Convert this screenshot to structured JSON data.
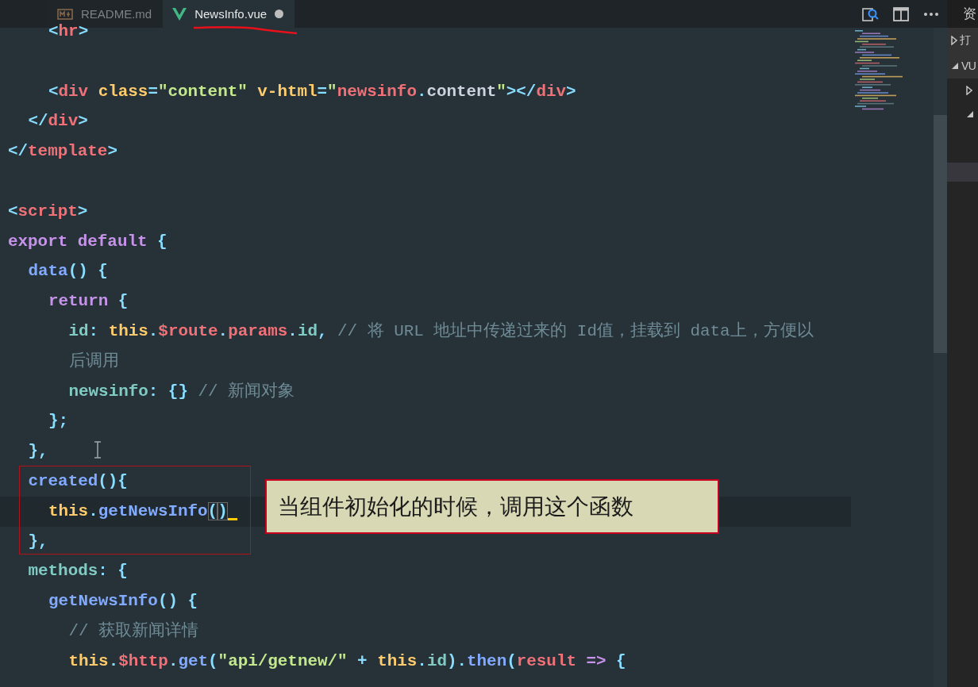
{
  "tabs": [
    {
      "label": "README.md",
      "kind": "markdown",
      "selected": false,
      "modified": false
    },
    {
      "label": "NewsInfo.vue",
      "kind": "vue",
      "selected": true,
      "modified": true
    }
  ],
  "editor": {
    "lines": [
      {
        "children": [
          {
            "children": [
              {
                "tokens": [
                  {
                    "kind": "punct",
                    "text": "<"
                  },
                  {
                    "kind": "tag",
                    "text": "hr"
                  },
                  {
                    "kind": "punct",
                    "text": ">"
                  }
                ]
              },
              {
                "kind": "blank"
              },
              {
                "tokens": [
                  {
                    "kind": "punct",
                    "text": "<"
                  },
                  {
                    "kind": "tag",
                    "text": "div "
                  },
                  {
                    "kind": "attr",
                    "text": "class"
                  },
                  {
                    "kind": "punct",
                    "text": "="
                  },
                  {
                    "kind": "string",
                    "text": "\"content\" "
                  },
                  {
                    "kind": "attr",
                    "text": "v-html"
                  },
                  {
                    "kind": "punct",
                    "text": "="
                  },
                  {
                    "kind": "string",
                    "text": "\""
                  },
                  {
                    "kind": "var",
                    "text": "newsinfo"
                  },
                  {
                    "kind": "punct",
                    "text": "."
                  },
                  {
                    "kind": "plain",
                    "text": "content"
                  },
                  {
                    "kind": "string",
                    "text": "\""
                  },
                  {
                    "kind": "punct",
                    "text": "></"
                  },
                  {
                    "kind": "tag",
                    "text": "div"
                  },
                  {
                    "kind": "punct",
                    "text": ">"
                  }
                ]
              }
            ]
          },
          {
            "tokens": [
              {
                "kind": "punct",
                "text": "</"
              },
              {
                "kind": "tag",
                "text": "div"
              },
              {
                "kind": "punct",
                "text": ">"
              }
            ]
          }
        ]
      },
      {
        "tokens": [
          {
            "kind": "punct",
            "text": "</"
          },
          {
            "kind": "tag",
            "text": "template"
          },
          {
            "kind": "punct",
            "text": ">"
          }
        ]
      },
      {
        "kind": "blank"
      },
      {
        "tokens": [
          {
            "kind": "punct",
            "text": "<"
          },
          {
            "kind": "tag",
            "text": "script"
          },
          {
            "kind": "punct",
            "text": ">"
          }
        ]
      },
      {
        "tokens": [
          {
            "kind": "keyword",
            "text": "export default"
          },
          {
            "kind": "punct",
            "text": " {"
          }
        ],
        "children": [
          {
            "tokens": [
              {
                "kind": "func",
                "text": "data"
              },
              {
                "kind": "punct",
                "text": "() {"
              }
            ],
            "children": [
              {
                "tokens": [
                  {
                    "kind": "keyword",
                    "text": "return"
                  },
                  {
                    "kind": "punct",
                    "text": " {"
                  }
                ],
                "children": [
                  {
                    "tokens": [
                      {
                        "kind": "prop",
                        "text": "id"
                      },
                      {
                        "kind": "punct",
                        "text": ": "
                      },
                      {
                        "kind": "this",
                        "text": "this"
                      },
                      {
                        "kind": "punct",
                        "text": "."
                      },
                      {
                        "kind": "var",
                        "text": "$route"
                      },
                      {
                        "kind": "punct",
                        "text": "."
                      },
                      {
                        "kind": "var",
                        "text": "params"
                      },
                      {
                        "kind": "punct",
                        "text": "."
                      },
                      {
                        "kind": "prop",
                        "text": "id"
                      },
                      {
                        "kind": "punct",
                        "text": ", "
                      },
                      {
                        "kind": "comment",
                        "text": "// 将 URL 地址中传递过来的 Id值，挂载到 data上，方便以"
                      }
                    ]
                  },
                  {
                    "tokens": [
                      {
                        "kind": "comment",
                        "text": "后调用"
                      }
                    ]
                  },
                  {
                    "tokens": [
                      {
                        "kind": "prop",
                        "text": "newsinfo"
                      },
                      {
                        "kind": "punct",
                        "text": ": {} "
                      },
                      {
                        "kind": "comment",
                        "text": "// 新闻对象"
                      }
                    ]
                  }
                ]
              },
              {
                "tokens": [
                  {
                    "kind": "punct",
                    "text": "};"
                  }
                ]
              }
            ]
          },
          {
            "tokens": [
              {
                "kind": "punct",
                "text": "},"
              }
            ]
          },
          {
            "tokens": [
              {
                "kind": "func",
                "text": "created"
              },
              {
                "kind": "punct",
                "text": "(){"
              }
            ],
            "children": [
              {
                "current": true,
                "caret": true,
                "tokens": [
                  {
                    "kind": "this",
                    "text": "this"
                  },
                  {
                    "kind": "punct",
                    "text": "."
                  },
                  {
                    "kind": "func",
                    "text": "getNewsInfo"
                  },
                  {
                    "kind": "match",
                    "text": "("
                  },
                  {
                    "kind": "match",
                    "text": ")"
                  }
                ]
              }
            ]
          },
          {
            "tokens": [
              {
                "kind": "punct",
                "text": "},"
              }
            ]
          },
          {
            "tokens": [
              {
                "kind": "prop",
                "text": "methods"
              },
              {
                "kind": "punct",
                "text": ": {"
              }
            ],
            "children": [
              {
                "tokens": [
                  {
                    "kind": "func",
                    "text": "getNewsInfo"
                  },
                  {
                    "kind": "punct",
                    "text": "() {"
                  }
                ],
                "children": [
                  {
                    "tokens": [
                      {
                        "kind": "comment",
                        "text": "// 获取新闻详情"
                      }
                    ]
                  },
                  {
                    "tokens": [
                      {
                        "kind": "this",
                        "text": "this"
                      },
                      {
                        "kind": "punct",
                        "text": "."
                      },
                      {
                        "kind": "var",
                        "text": "$http"
                      },
                      {
                        "kind": "punct",
                        "text": "."
                      },
                      {
                        "kind": "func",
                        "text": "get"
                      },
                      {
                        "kind": "punct",
                        "text": "("
                      },
                      {
                        "kind": "string",
                        "text": "\"api/getnew/\""
                      },
                      {
                        "kind": "punct",
                        "text": " + "
                      },
                      {
                        "kind": "this",
                        "text": "this"
                      },
                      {
                        "kind": "punct",
                        "text": "."
                      },
                      {
                        "kind": "prop",
                        "text": "id"
                      },
                      {
                        "kind": "punct",
                        "text": ")."
                      },
                      {
                        "kind": "func",
                        "text": "then"
                      },
                      {
                        "kind": "punct",
                        "text": "("
                      },
                      {
                        "kind": "var",
                        "text": "result"
                      },
                      {
                        "kind": "keyword",
                        "text": " =>"
                      },
                      {
                        "kind": "punct",
                        "text": " {"
                      }
                    ]
                  }
                ]
              }
            ]
          }
        ]
      }
    ]
  },
  "annotations": [
    {
      "kind": "underline"
    },
    {
      "kind": "frame"
    },
    {
      "kind": "callout",
      "text": "当组件初始化的时候，调用这个函数"
    }
  ],
  "sidebar": {
    "header": "资",
    "items": [
      {
        "label": "打",
        "expanded": false
      },
      {
        "label": "VU",
        "expanded": true
      },
      {
        "expanded": false
      },
      {
        "expanded": true
      }
    ]
  }
}
